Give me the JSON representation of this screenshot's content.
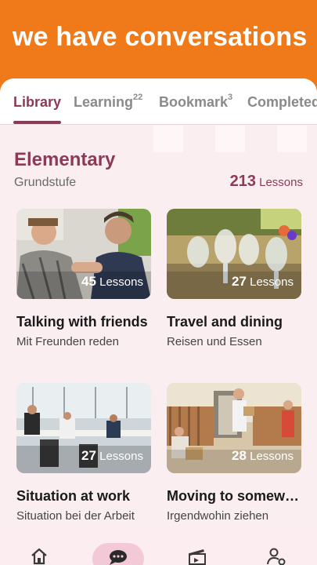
{
  "banner": {
    "title": "we have conversations"
  },
  "tabs": [
    {
      "label": "Library",
      "count": ""
    },
    {
      "label": "Learning",
      "count": "22"
    },
    {
      "label": "Bookmark",
      "count": "3"
    },
    {
      "label": "Completed",
      "count": ""
    }
  ],
  "section": {
    "title": "Elementary",
    "subtitle": "Grundstufe",
    "lesson_count": "213",
    "lesson_word": "Lessons"
  },
  "cards": [
    {
      "title": "Talking with friends",
      "subtitle": "Mit Freunden reden",
      "lessons": "45",
      "lessons_word": "Lessons"
    },
    {
      "title": "Travel and dining",
      "subtitle": "Reisen und Essen",
      "lessons": "27",
      "lessons_word": "Lessons"
    },
    {
      "title": "Situation at work",
      "subtitle": "Situation bei der Arbeit",
      "lessons": "27",
      "lessons_word": "Lessons"
    },
    {
      "title": "Moving to somewhere",
      "subtitle": "Irgendwohin ziehen",
      "lessons": "28",
      "lessons_word": "Lessons"
    }
  ],
  "nav": {
    "items": [
      "home-icon",
      "chat-icon",
      "clapperboard-icon",
      "user-settings-icon"
    ],
    "active": "chat-icon"
  },
  "colors": {
    "banner": "#f07a1a",
    "accent": "#8b3a58"
  }
}
